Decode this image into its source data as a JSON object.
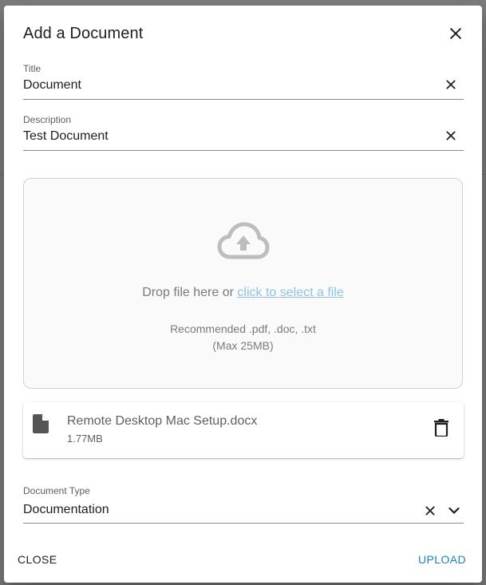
{
  "dialog": {
    "title": "Add a Document"
  },
  "fields": {
    "title": {
      "label": "Title",
      "value": "Document"
    },
    "description": {
      "label": "Description",
      "value": "Test Document"
    }
  },
  "dropzone": {
    "prompt": "Drop file here or ",
    "link": "click to select a file",
    "recommended": "Recommended .pdf, .doc, .txt",
    "max_size": "(Max 25MB)"
  },
  "file": {
    "name": "Remote Desktop Mac Setup.docx",
    "size": "1.77MB",
    "icon": "document-icon"
  },
  "document_type": {
    "label": "Document Type",
    "value": "Documentation"
  },
  "actions": {
    "close": "CLOSE",
    "upload": "UPLOAD"
  },
  "colors": {
    "accent": "#1b85b8",
    "link": "#8fc3e5"
  }
}
